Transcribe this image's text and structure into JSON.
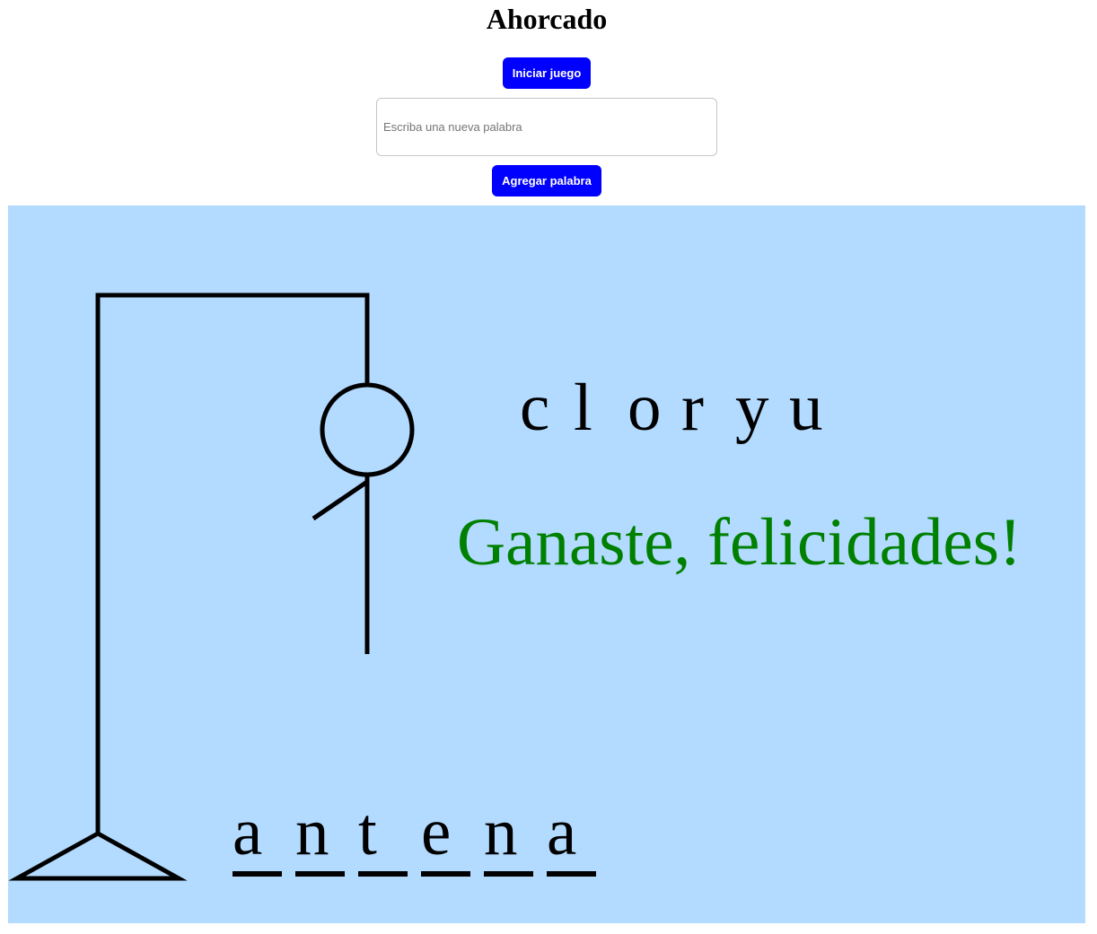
{
  "header": {
    "title": "Ahorcado"
  },
  "controls": {
    "start_label": "Iniciar juego",
    "new_word_placeholder": "Escriba una nueva palabra",
    "new_word_value": "",
    "add_label": "Agregar palabra"
  },
  "game": {
    "background_color": "#b3daff",
    "wrong_letters": [
      "c",
      "l",
      "o",
      "r",
      "y",
      "u"
    ],
    "word_letters": [
      "a",
      "n",
      "t",
      "e",
      "n",
      "a"
    ],
    "message": "Ganaste, felicidades!",
    "message_color": "#008000",
    "parts_drawn": [
      "head",
      "body",
      "left-arm"
    ]
  }
}
